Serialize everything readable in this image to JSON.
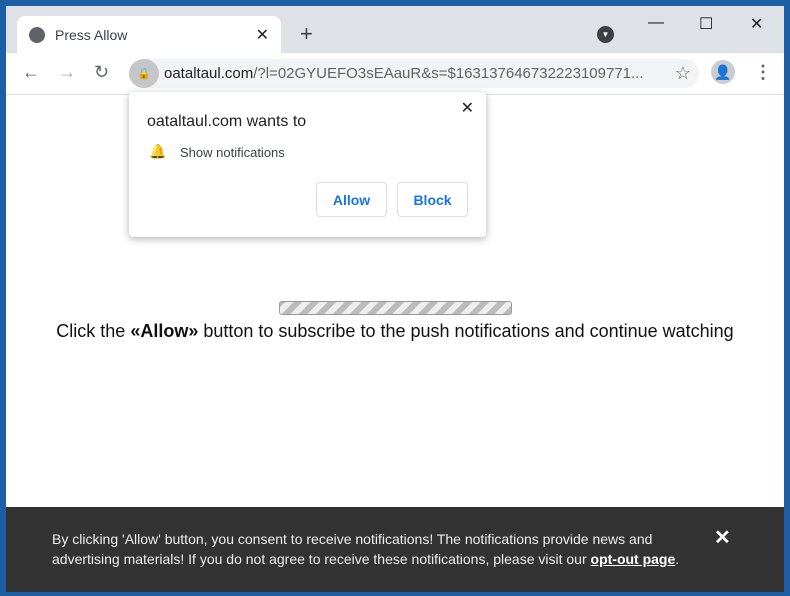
{
  "tab": {
    "title": "Press Allow",
    "icon": "globe-icon"
  },
  "address": {
    "domain": "oataltaul.com",
    "path": "/?l=02GYUEFO3sEAauR&s=$163137646732223109771..."
  },
  "popup": {
    "heading": "oataltaul.com wants to",
    "permission": "Show notifications",
    "allow": "Allow",
    "block": "Block"
  },
  "page": {
    "before": "Click the ",
    "allow": "«Allow»",
    "after": " button to subscribe to the push notifications and continue watching"
  },
  "banner": {
    "text": "By clicking 'Allow' button, you consent to receive notifications! The notifications provide news and advertising materials! If you do not agree to receive these notifications, please visit our ",
    "link": "opt-out page",
    "end": "."
  },
  "colors": {
    "frame": "#1c5fa6",
    "accent": "#1a73e8",
    "banner": "#333333"
  }
}
